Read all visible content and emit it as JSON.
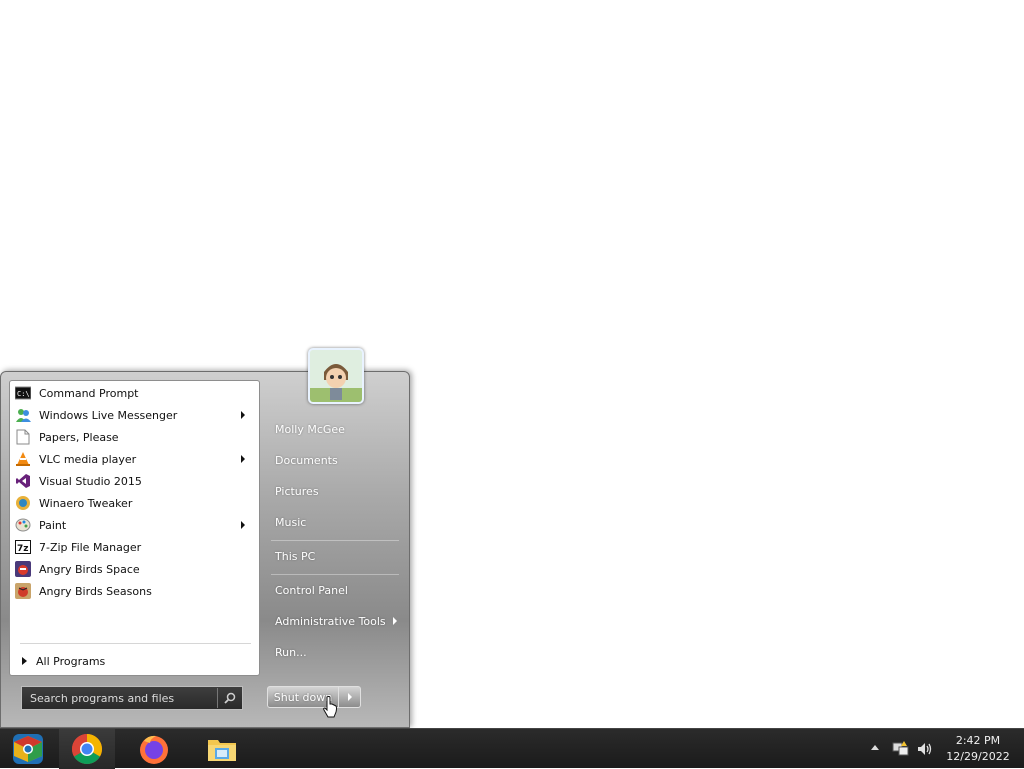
{
  "start_menu": {
    "programs": [
      {
        "label": "Command Prompt",
        "icon": "command-prompt-icon",
        "submenu": false
      },
      {
        "label": "Windows Live Messenger",
        "icon": "messenger-icon",
        "submenu": true
      },
      {
        "label": "Papers, Please",
        "icon": "document-icon",
        "submenu": false
      },
      {
        "label": "VLC media player",
        "icon": "vlc-cone-icon",
        "submenu": true
      },
      {
        "label": "Visual Studio 2015",
        "icon": "visual-studio-icon",
        "submenu": false
      },
      {
        "label": "Winaero Tweaker",
        "icon": "winaero-icon",
        "submenu": false
      },
      {
        "label": "Paint",
        "icon": "paint-palette-icon",
        "submenu": true
      },
      {
        "label": "7-Zip File Manager",
        "icon": "7zip-icon",
        "submenu": false
      },
      {
        "label": "Angry Birds Space",
        "icon": "angry-birds-space-icon",
        "submenu": false
      },
      {
        "label": "Angry Birds Seasons",
        "icon": "angry-birds-seasons-icon",
        "submenu": false
      }
    ],
    "all_programs_label": "All Programs",
    "search": {
      "placeholder": "Search programs and files"
    },
    "right_items": [
      {
        "label": "Molly McGee",
        "submenu": false
      },
      {
        "label": "Documents",
        "submenu": false
      },
      {
        "label": "Pictures",
        "submenu": false
      },
      {
        "label": "Music",
        "submenu": false
      },
      {
        "label": "This PC",
        "submenu": false
      },
      {
        "label": "Control Panel",
        "submenu": false
      },
      {
        "label": "Administrative Tools",
        "submenu": true
      },
      {
        "label": "Run...",
        "submenu": false
      }
    ],
    "shutdown_label": "Shut down"
  },
  "taskbar": {
    "pinned": [
      "start-orb-icon",
      "chrome-icon",
      "firefox-icon",
      "file-explorer-icon"
    ],
    "clock": {
      "time": "2:42 PM",
      "date": "12/29/2022"
    }
  }
}
